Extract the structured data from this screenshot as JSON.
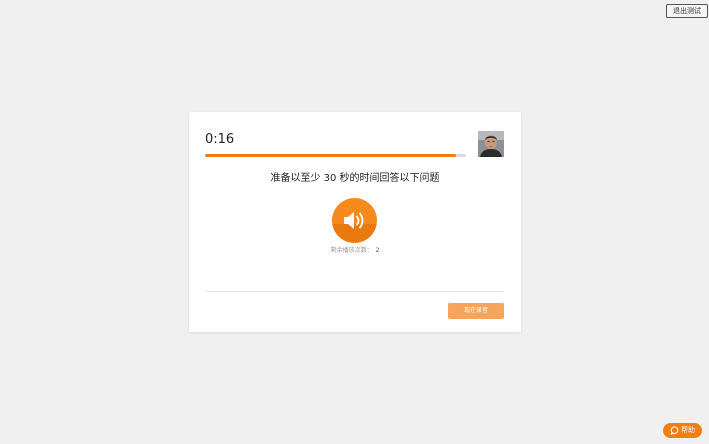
{
  "header": {
    "exit_label": "退出测试"
  },
  "card": {
    "timer": "0:16",
    "progress_fraction": 0.96,
    "prompt": "准备以至少 30 秒的时间回答以下问题",
    "audio_icon": "speaker-volume-icon",
    "plays_left_label": "剩余播放次数：",
    "plays_left_count": "2",
    "record_label": "现在录音"
  },
  "help": {
    "label": "帮助",
    "icon": "chat-bubble-icon"
  },
  "colors": {
    "background": "#f0f0f0",
    "accent": "#f07f12",
    "accent_light": "#f6a45b",
    "progress_track": "#dcdcdc"
  }
}
